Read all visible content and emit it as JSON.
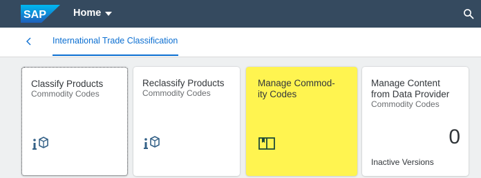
{
  "shell": {
    "logo_text": "SAP",
    "home_label": "Home",
    "brand_color": "#354a5f",
    "icons": [
      "sap-logo",
      "chevron-down-icon",
      "search-icon"
    ]
  },
  "header": {
    "back_icon": "chevron-left-icon",
    "breadcrumb": "International Trade Classification"
  },
  "tiles": [
    {
      "title": "Classify Products",
      "subtitle": "Commodity Codes",
      "icon": "classify-icon"
    },
    {
      "title": "Reclassify Products",
      "subtitle": "Commodity Codes",
      "icon": "classify-icon"
    },
    {
      "title_line1": "Manage Commod-",
      "title_line2": "ity Codes",
      "icon": "open-book-icon",
      "highlight_color": "#fff450"
    },
    {
      "title_line1": "Manage Content",
      "title_line2": "from Data Provider",
      "subtitle": "Commodity Codes",
      "kpi": "0",
      "footer": "Inactive Versions"
    }
  ]
}
